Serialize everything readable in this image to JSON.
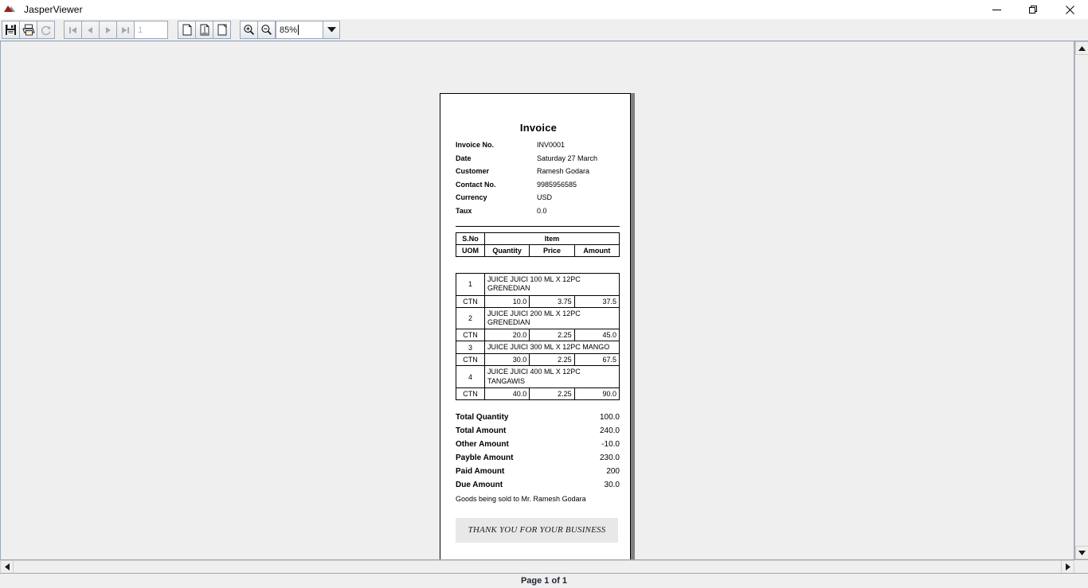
{
  "window": {
    "title": "JasperViewer",
    "icon": "jasper-mountain-icon",
    "controls": {
      "minimize": "─",
      "maximize": "❐",
      "close": "✕"
    }
  },
  "toolbar": {
    "save_label": "save-icon",
    "print_label": "print-icon",
    "reload_label": "reload-icon",
    "first_page_label": "⏮",
    "prev_page_label": "◀",
    "next_page_label": "▶",
    "last_page_label": "⏭",
    "page_number_value": "1",
    "actual_size_label": "actual-size-icon",
    "fit_page_label": "fit-page-icon",
    "fit_width_label": "fit-width-icon",
    "zoom_in_label": "zoom-in-icon",
    "zoom_out_label": "zoom-out-icon",
    "zoom_value": "85%",
    "zoom_dropdown_label": "▼"
  },
  "statusbar": {
    "page_status": "Page 1 of 1"
  },
  "document": {
    "title": "Invoice",
    "fields": [
      {
        "label": "Invoice No.",
        "value": "INV0001"
      },
      {
        "label": "Date",
        "value": "Saturday 27 March"
      },
      {
        "label": "Customer",
        "value": "Ramesh Godara"
      },
      {
        "label": "Contact No.",
        "value": "9985956585"
      },
      {
        "label": "Currency",
        "value": "USD"
      },
      {
        "label": "Taux",
        "value": "0.0"
      }
    ],
    "table_headers": {
      "sno": "S.No",
      "item": "Item",
      "uom": "UOM",
      "quantity": "Quantity",
      "price": "Price",
      "amount": "Amount"
    },
    "line_items": [
      {
        "sno": "1",
        "description": "JUICE JUICI 100 ML X 12PC GRENEDIAN",
        "uom": "CTN",
        "quantity": "10.0",
        "price": "3.75",
        "amount": "37.5"
      },
      {
        "sno": "2",
        "description": "JUICE JUICI 200 ML X 12PC GRENEDIAN",
        "uom": "CTN",
        "quantity": "20.0",
        "price": "2.25",
        "amount": "45.0"
      },
      {
        "sno": "3",
        "description": "JUICE JUICI 300 ML X 12PC MANGO",
        "uom": "CTN",
        "quantity": "30.0",
        "price": "2.25",
        "amount": "67.5"
      },
      {
        "sno": "4",
        "description": "JUICE JUICI 400 ML X 12PC TANGAWIS",
        "uom": "CTN",
        "quantity": "40.0",
        "price": "2.25",
        "amount": "90.0"
      }
    ],
    "totals": [
      {
        "label": "Total Quantity",
        "value": "100.0"
      },
      {
        "label": "Total Amount",
        "value": "240.0"
      },
      {
        "label": "Other Amount",
        "value": "-10.0"
      },
      {
        "label": "Payble Amount",
        "value": "230.0"
      },
      {
        "label": "Paid Amount",
        "value": "200"
      },
      {
        "label": "Due Amount",
        "value": "30.0"
      }
    ],
    "note": "Goods being sold to Mr. Ramesh Godara",
    "footer_message": "THANK YOU FOR YOUR BUSINESS"
  },
  "colors": {
    "toolbar_bg": "#efefef",
    "canvas_bg": "#efefef",
    "page_bg": "#ffffff",
    "page_shadow": "#808080",
    "footer_box_bg": "#e8e8e8",
    "border": "#9aa7b8",
    "title_icon": "#9c2020"
  }
}
